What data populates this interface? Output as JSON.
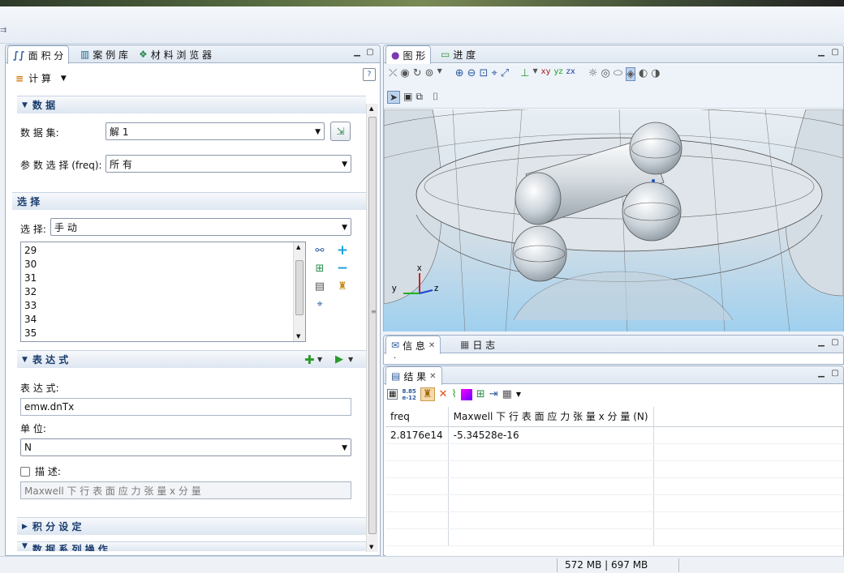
{
  "left_panel": {
    "tabs": [
      {
        "label": "面 积 分",
        "icon": "integral-icon"
      },
      {
        "label": "案 例 库",
        "icon": "library-icon"
      },
      {
        "label": "材 料 浏 览 器",
        "icon": "materials-icon"
      }
    ],
    "compute_label": "计 算",
    "data_section": {
      "title": "数 据",
      "dataset_label": "数 据 集:",
      "dataset_value": "解 1",
      "param_label": "参 数 选 择 (freq):",
      "param_value": "所 有"
    },
    "selection_section": {
      "title": "选 择",
      "select_label": "选 择:",
      "select_value": "手 动",
      "items": [
        "29",
        "30",
        "31",
        "32",
        "33",
        "34",
        "35"
      ]
    },
    "expression_section": {
      "title": "表 达 式",
      "expr_label": "表 达 式:",
      "expr_value": "emw.dnTx",
      "unit_label": "单 位:",
      "unit_value": "N",
      "desc_label": "描 述:",
      "desc_value": "Maxwell 下 行 表 面 应 力 张 量 x 分 量",
      "desc_checked": false
    },
    "integration_section": {
      "title": "积 分 设 定"
    },
    "series_section": {
      "title": "数 据 系 列 操 作"
    }
  },
  "graphics_panel": {
    "tabs": [
      {
        "label": "图 形",
        "icon": "graphics-icon"
      },
      {
        "label": "进 度",
        "icon": "progress-icon"
      }
    ],
    "axes": {
      "x": "x",
      "y": "y",
      "z": "z"
    }
  },
  "info_panel": {
    "tabs": [
      {
        "label": "信 息",
        "icon": "message-icon"
      },
      {
        "label": "日 志",
        "icon": "log-icon"
      }
    ],
    "dot": "."
  },
  "results_panel": {
    "tab_label": "结 果",
    "precision_icon_label_top": "8.85",
    "precision_icon_label_bottom": "e-12",
    "columns": [
      "freq",
      "Maxwell 下 行 表 面 应 力 张 量 x 分 量 (N)"
    ],
    "rows": [
      [
        "2.8176e14",
        "-5.34528e-16"
      ]
    ]
  },
  "status_bar": {
    "memory": "572 MB | 697 MB"
  }
}
